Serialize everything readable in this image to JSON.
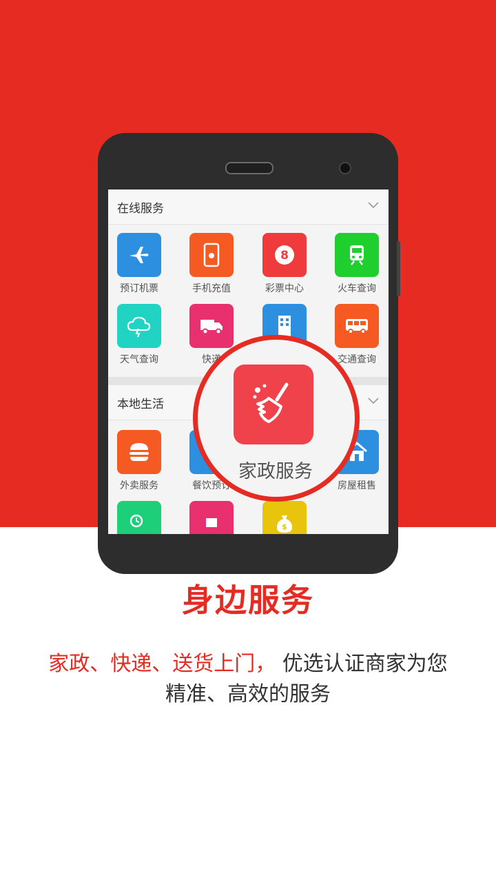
{
  "colors": {
    "brand_red": "#e62b22",
    "screen_bg": "#f4f4f4",
    "phone_body": "#2d2d2d",
    "text_dark": "#333333"
  },
  "online_services": {
    "title": "在线服务",
    "items": [
      {
        "label": "预订机票",
        "icon": "airplane-icon",
        "color": "#2d8fe0"
      },
      {
        "label": "手机充值",
        "icon": "phone-recharge-icon",
        "color": "#f55a22"
      },
      {
        "label": "彩票中心",
        "icon": "lottery-icon",
        "color": "#ef3b3b"
      },
      {
        "label": "火车查询",
        "icon": "train-icon",
        "color": "#1ecf2e"
      },
      {
        "label": "天气查询",
        "icon": "weather-icon",
        "color": "#21d3c2"
      },
      {
        "label": "快递",
        "icon": "delivery-truck-icon",
        "color": "#e8306f"
      },
      {
        "label": "",
        "icon": "building-icon",
        "color": "#2d8fe0"
      },
      {
        "label": "交通查询",
        "icon": "bus-icon",
        "color": "#f55a22"
      }
    ]
  },
  "local_life": {
    "title": "本地生活",
    "items": [
      {
        "label": "外卖服务",
        "icon": "burger-icon",
        "color": "#f55a22"
      },
      {
        "label": "餐饮预订",
        "icon": "restaurant-icon",
        "color": "#2d8fe0"
      },
      {
        "label": "房屋租售",
        "icon": "house-icon",
        "color": "#2d8fe0"
      },
      {
        "label": "",
        "icon": "clock-delivery-icon",
        "color": "#1ecf7a"
      },
      {
        "label": "",
        "icon": "package-icon",
        "color": "#e8306f"
      },
      {
        "label": "",
        "icon": "money-bag-icon",
        "color": "#e8c40c"
      }
    ]
  },
  "zoom": {
    "label": "家政服务",
    "icon": "broom-icon"
  },
  "headline": "身边服务",
  "description": {
    "highlight": "家政、快递、送货上门，",
    "rest_line1": " 优选认证商家为您",
    "line2": "精准、高效的服务"
  }
}
